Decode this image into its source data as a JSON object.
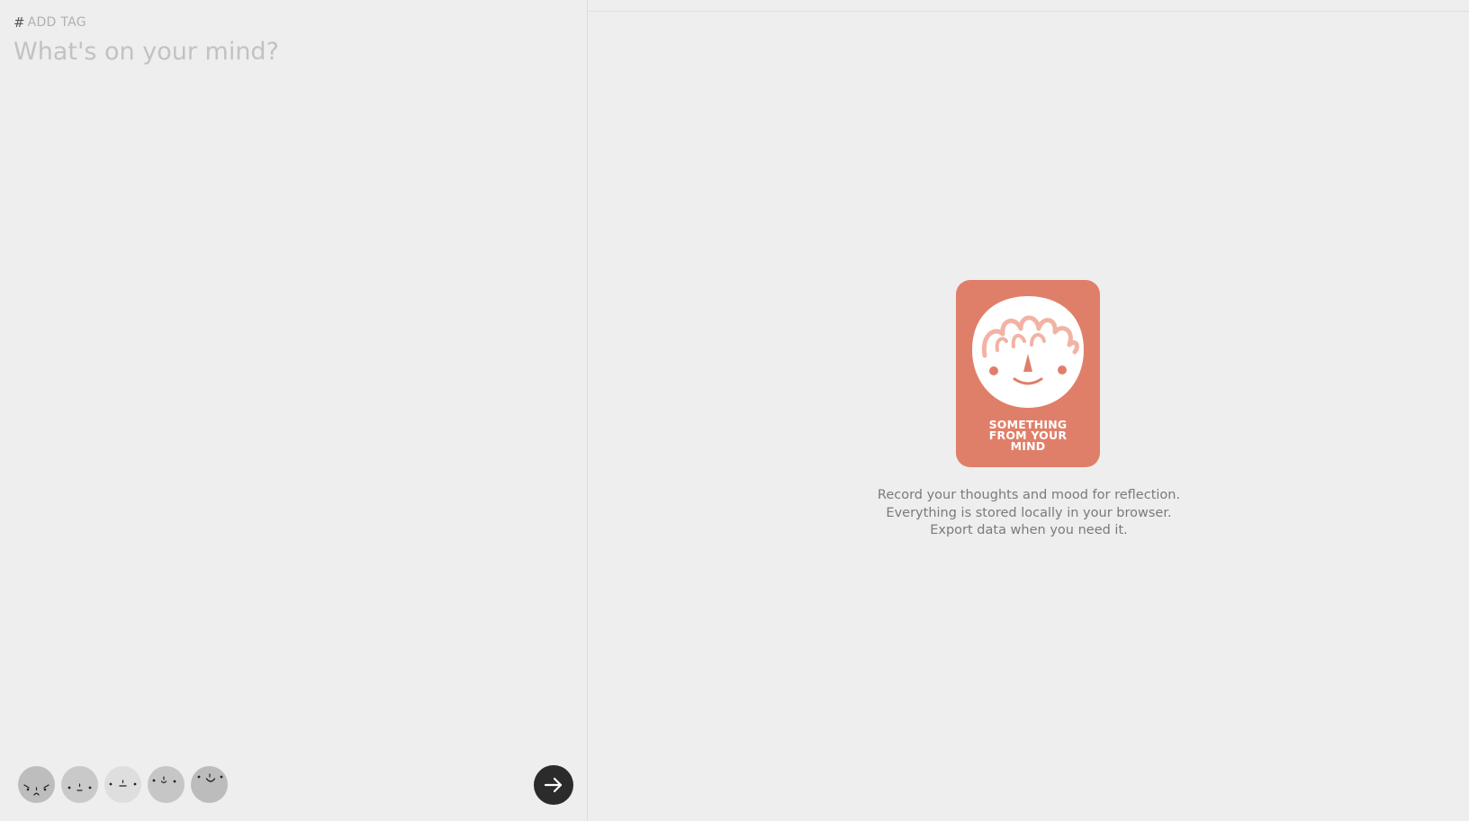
{
  "composer": {
    "tag_hash": "#",
    "tag_label": "ADD TAG",
    "input_placeholder": "What's on your mind?",
    "input_value": "",
    "moods": [
      {
        "name": "angry-mood-icon"
      },
      {
        "name": "sad-mood-icon"
      },
      {
        "name": "neutral-mood-icon"
      },
      {
        "name": "content-mood-icon"
      },
      {
        "name": "happy-mood-icon"
      }
    ],
    "submit_icon": "arrow-right-icon"
  },
  "preview": {
    "logo": {
      "line1": "SOMETHING",
      "line2": "FROM YOUR",
      "line3": "MIND",
      "color": "#e07f69"
    },
    "empty_state": {
      "line1": "Record your thoughts and mood for reflection.",
      "line2": "Everything is stored locally in your browser.",
      "line3": "Export data when you need it."
    }
  },
  "colors": {
    "background": "#eeeeee",
    "submit_button": "#2b2b2b",
    "placeholder": "#c2c2c2",
    "accent": "#e07f69"
  }
}
